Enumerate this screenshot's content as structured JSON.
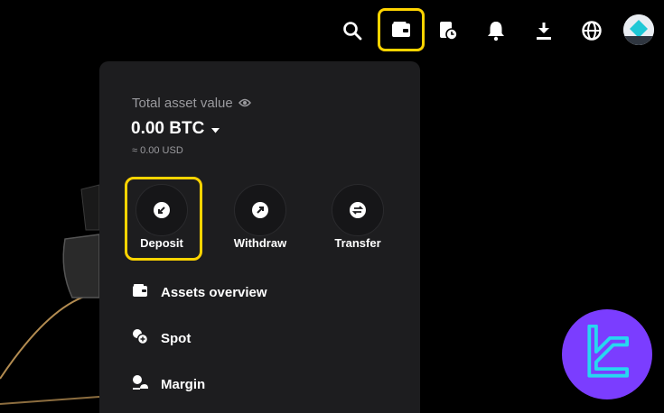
{
  "topbar": {
    "icons": [
      "search-icon",
      "wallet-icon",
      "orders-history-icon",
      "bell-icon",
      "download-icon",
      "globe-icon",
      "avatar"
    ],
    "highlight_color": "#ffd400"
  },
  "assets_panel": {
    "total_label": "Total asset value",
    "btc_value": "0.00 BTC",
    "usd_value": "≈ 0.00 USD",
    "actions": [
      {
        "label": "Deposit",
        "icon": "deposit-arrow-icon"
      },
      {
        "label": "Withdraw",
        "icon": "withdraw-arrow-icon"
      },
      {
        "label": "Transfer",
        "icon": "transfer-icon"
      }
    ],
    "menu": [
      {
        "label": "Assets overview",
        "icon": "wallet-small-icon"
      },
      {
        "label": "Spot",
        "icon": "spot-icon"
      },
      {
        "label": "Margin",
        "icon": "margin-icon"
      }
    ]
  },
  "colors": {
    "panel_bg": "#1d1d1f",
    "highlight": "#ffd400",
    "badge": "#7b3dff",
    "badge_logo": "#27d7f0"
  }
}
